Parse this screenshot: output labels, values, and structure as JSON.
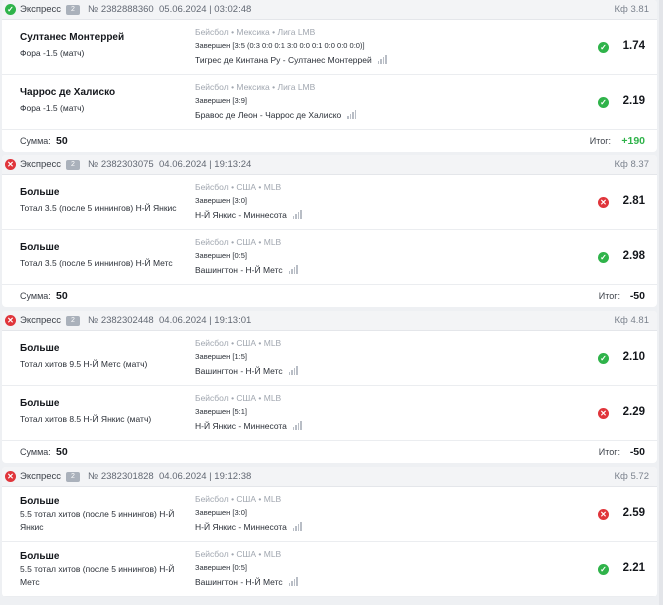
{
  "bets": [
    {
      "status": "win",
      "type": "Экспресс",
      "badge": "2",
      "number": "№ 2382888360",
      "datetime": "05.06.2024 | 03:02:48",
      "kf": "Кф 3.81",
      "events": [
        {
          "name": "Султанес Монтеррей",
          "market": "Фора -1.5 (матч)",
          "sport": "Бейсбол",
          "country": "Мексика",
          "league": "Лига LMB",
          "state": "Завершен [3:5 (0:3 0:0 0:1 3:0 0:0 0:1 0:0 0:0 0:0)]",
          "teams": "Тигрес де Кинтана Ру - Султанес Монтеррей",
          "result": "win",
          "odds": "1.74"
        },
        {
          "name": "Чаррос де Халиско",
          "market": "Фора -1.5 (матч)",
          "sport": "Бейсбол",
          "country": "Мексика",
          "league": "Лига LMB",
          "state": "Завершен [3:9]",
          "teams": "Бравос де Леон - Чаррос де Халиско",
          "result": "win",
          "odds": "2.19"
        }
      ],
      "sum_label": "Сумма:",
      "sum": "50",
      "total_label": "Итог:",
      "total": "+190",
      "total_type": "pos"
    },
    {
      "status": "lose",
      "type": "Экспресс",
      "badge": "2",
      "number": "№ 2382303075",
      "datetime": "04.06.2024 | 19:13:24",
      "kf": "Кф 8.37",
      "events": [
        {
          "name": "Больше",
          "market": "Тотал 3.5 (после 5 иннингов) Н-Й Янкис",
          "sport": "Бейсбол",
          "country": "США",
          "league": "MLB",
          "state": "Завершен [3:0]",
          "teams": "Н-Й Янкис - Миннесота",
          "result": "lose",
          "odds": "2.81"
        },
        {
          "name": "Больше",
          "market": "Тотал 3.5 (после 5 иннингов) Н-Й Метс",
          "sport": "Бейсбол",
          "country": "США",
          "league": "MLB",
          "state": "Завершен [0:5]",
          "teams": "Вашингтон - Н-Й Метс",
          "result": "win",
          "odds": "2.98"
        }
      ],
      "sum_label": "Сумма:",
      "sum": "50",
      "total_label": "Итог:",
      "total": "-50",
      "total_type": "neg"
    },
    {
      "status": "lose",
      "type": "Экспресс",
      "badge": "2",
      "number": "№ 2382302448",
      "datetime": "04.06.2024 | 19:13:01",
      "kf": "Кф 4.81",
      "events": [
        {
          "name": "Больше",
          "market": "Тотал хитов 9.5 Н-Й Метс (матч)",
          "sport": "Бейсбол",
          "country": "США",
          "league": "MLB",
          "state": "Завершен [1:5]",
          "teams": "Вашингтон - Н-Й Метс",
          "result": "win",
          "odds": "2.10"
        },
        {
          "name": "Больше",
          "market": "Тотал хитов 8.5 Н-Й Янкис (матч)",
          "sport": "Бейсбол",
          "country": "США",
          "league": "MLB",
          "state": "Завершен [5:1]",
          "teams": "Н-Й Янкис - Миннесота",
          "result": "lose",
          "odds": "2.29"
        }
      ],
      "sum_label": "Сумма:",
      "sum": "50",
      "total_label": "Итог:",
      "total": "-50",
      "total_type": "neg"
    },
    {
      "status": "lose",
      "type": "Экспресс",
      "badge": "2",
      "number": "№ 2382301828",
      "datetime": "04.06.2024 | 19:12:38",
      "kf": "Кф 5.72",
      "events": [
        {
          "name": "Больше",
          "market": "5.5 тотал хитов (после 5 иннингов) Н-Й Янкис",
          "sport": "Бейсбол",
          "country": "США",
          "league": "MLB",
          "state": "Завершен [3:0]",
          "teams": "Н-Й Янкис - Миннесота",
          "result": "lose",
          "odds": "2.59"
        },
        {
          "name": "Больше",
          "market": "5.5 тотал хитов (после 5 иннингов) Н-Й Метс",
          "sport": "Бейсбол",
          "country": "США",
          "league": "MLB",
          "state": "Завершен [0:5]",
          "teams": "Вашингтон - Н-Й Метс",
          "result": "win",
          "odds": "2.21"
        }
      ]
    }
  ],
  "icons": {
    "win": "check-icon",
    "lose": "cross-icon",
    "stats": "stats-bars-icon"
  },
  "colors": {
    "win": "#2fb34a",
    "lose": "#e0353b",
    "header_bg": "#f3f4f6",
    "page_bg": "#eef0f3"
  }
}
